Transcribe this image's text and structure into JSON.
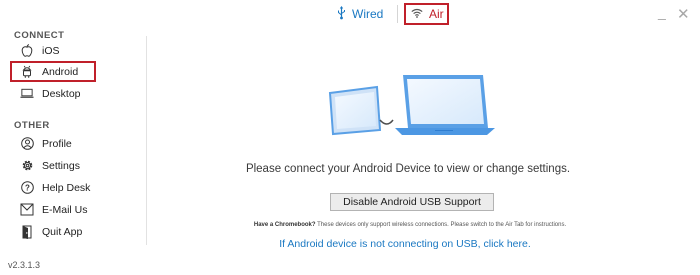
{
  "tabs": [
    {
      "label": "Wired",
      "icon": "usb-icon",
      "selected": false
    },
    {
      "label": "Air",
      "icon": "wifi-icon",
      "selected": true
    }
  ],
  "window_controls": {
    "minimize_icon": "minimize-icon",
    "close_icon": "close-icon"
  },
  "sidebar": {
    "connect_header": "CONNECT",
    "connect_items": [
      {
        "label": "iOS",
        "icon": "apple-icon"
      },
      {
        "label": "Android",
        "icon": "android-icon",
        "active": true
      },
      {
        "label": "Desktop",
        "icon": "laptop-icon"
      }
    ],
    "other_header": "OTHER",
    "other_items": [
      {
        "label": "Profile",
        "icon": "profile-icon"
      },
      {
        "label": "Settings",
        "icon": "gear-icon"
      },
      {
        "label": "Help Desk",
        "icon": "help-icon"
      },
      {
        "label": "E-Mail Us",
        "icon": "email-icon"
      },
      {
        "label": "Quit App",
        "icon": "quit-icon"
      }
    ],
    "version": "v2.3.1.3"
  },
  "main": {
    "illustration_icon": "tablet-laptop-connection-icon",
    "message": "Please connect your Android Device to view or change settings.",
    "disable_button": "Disable Android USB Support",
    "chromebook_bold": "Have a Chromebook?",
    "chromebook_text": " These devices only support wireless connections. Please switch to the Air Tab for instructions.",
    "usb_link": "If Android device is not connecting on USB, click here."
  },
  "colors": {
    "accent_blue": "#1a78c2",
    "highlight_red": "#c0202a"
  }
}
